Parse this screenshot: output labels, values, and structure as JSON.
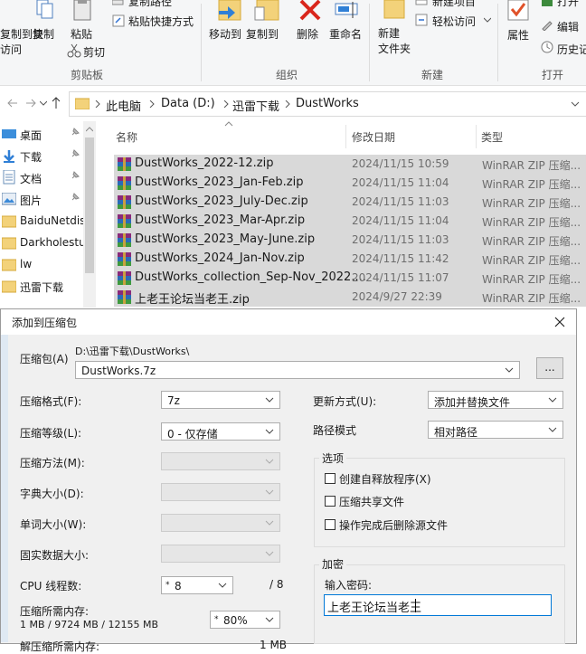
{
  "ribbon": {
    "cut_partial": "复制到快",
    "access_partial": "访问",
    "copy": "复制",
    "paste": "粘贴",
    "copy_path": "复制路径",
    "paste_shortcut": "粘贴快捷方式",
    "cut": "剪切",
    "move_to": "移动到",
    "copy_to": "复制到",
    "delete": "删除",
    "rename": "重命名",
    "new_folder": "新建\n文件夹",
    "new_item": "新建项目",
    "easy_access": "轻松访问",
    "properties": "属性",
    "open": "打开",
    "edit": "编辑",
    "history": "历史记",
    "groups": {
      "clipboard": "剪贴板",
      "organize": "组织",
      "new": "新建",
      "open": "打开"
    }
  },
  "address": {
    "crumbs": [
      "此电脑",
      "Data (D:)",
      "迅雷下载",
      "DustWorks"
    ]
  },
  "nav": {
    "items": [
      "桌面",
      "下载",
      "文档",
      "图片",
      "BaiduNetdis",
      "Darkholestu",
      "lw",
      "迅雷下载"
    ]
  },
  "filelist": {
    "headers": {
      "name": "名称",
      "date": "修改日期",
      "type": "类型"
    },
    "rows": [
      {
        "name": "DustWorks_2022-12.zip",
        "date": "2024/11/15 10:59",
        "type": "WinRAR ZIP 压缩..."
      },
      {
        "name": "DustWorks_2023_Jan-Feb.zip",
        "date": "2024/11/15 11:04",
        "type": "WinRAR ZIP 压缩..."
      },
      {
        "name": "DustWorks_2023_July-Dec.zip",
        "date": "2024/11/15 11:03",
        "type": "WinRAR ZIP 压缩..."
      },
      {
        "name": "DustWorks_2023_Mar-Apr.zip",
        "date": "2024/11/15 11:04",
        "type": "WinRAR ZIP 压缩..."
      },
      {
        "name": "DustWorks_2023_May-June.zip",
        "date": "2024/11/15 11:03",
        "type": "WinRAR ZIP 压缩..."
      },
      {
        "name": "DustWorks_2024_Jan-Nov.zip",
        "date": "2024/11/15 11:42",
        "type": "WinRAR ZIP 压缩..."
      },
      {
        "name": "DustWorks_collection_Sep-Nov_2022....",
        "date": "2024/11/15 11:07",
        "type": "WinRAR ZIP 压缩..."
      },
      {
        "name": "上老王论坛当老王.zip",
        "date": "2024/9/27 22:39",
        "type": "WinRAR ZIP 压缩..."
      }
    ]
  },
  "dialog": {
    "title": "添加到压缩包",
    "archive_label": "压缩包(A)",
    "archive_path": "D:\\迅雷下载\\DustWorks\\",
    "archive_name": "DustWorks.7z",
    "browse": "...",
    "format_label": "压缩格式(F):",
    "format_value": "7z",
    "level_label": "压缩等级(L):",
    "level_value": "0 - 仅存储",
    "method_label": "压缩方法(M):",
    "dict_label": "字典大小(D):",
    "word_label": "单词大小(W):",
    "solid_label": "固实数据大小:",
    "cpu_label": "CPU 线程数:",
    "cpu_value": "8",
    "cpu_total": "/ 8",
    "mem_label": "压缩所需内存:",
    "mem_value": "1 MB / 9724 MB / 12155 MB",
    "mem_pct": "80%",
    "decomp_label": "解压缩所需内存:",
    "decomp_value": "1 MB",
    "update_label": "更新方式(U):",
    "update_value": "添加并替换文件",
    "pathmode_label": "路径模式",
    "pathmode_value": "相对路径",
    "options_title": "选项",
    "opt_sfx": "创建自释放程序(X)",
    "opt_shared": "压缩共享文件",
    "opt_delete": "操作完成后删除源文件",
    "encrypt_title": "加密",
    "password_label": "输入密码:",
    "password_value": "上老王论坛当老王"
  }
}
